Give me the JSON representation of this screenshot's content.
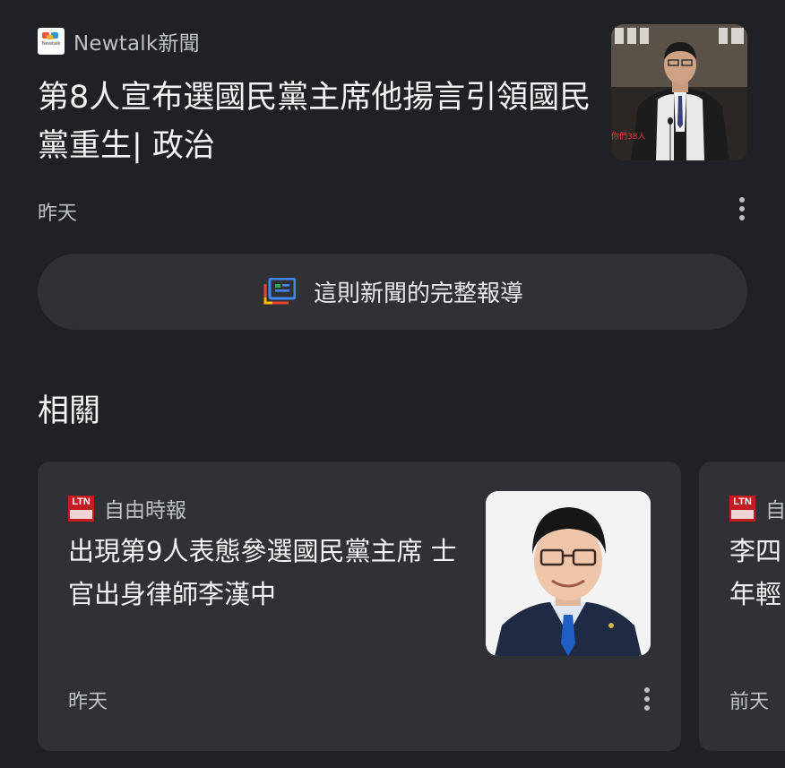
{
  "top_article": {
    "source": "Newtalk新聞",
    "logo_text": "Newtalk",
    "headline": "第8人宣布選國民黨主席他揚言引領國民黨重生| 政治",
    "date": "昨天",
    "thumbnail_caption": "你們38人"
  },
  "full_coverage": {
    "label": "這則新聞的完整報導"
  },
  "related": {
    "title": "相關",
    "cards": [
      {
        "source": "自由時報",
        "logo_text": "LTN",
        "title": "出現第9人表態參選國民黨主席 士官出身律師李漢中",
        "date": "昨天"
      },
      {
        "source": "自",
        "logo_text": "LTN",
        "title_line1": "李四",
        "title_line2": "年輕",
        "date": "前天"
      }
    ]
  },
  "colors": {
    "background": "#202124",
    "surface": "#303134",
    "text_primary": "#f1f3f4",
    "text_secondary": "#bdc1c6",
    "ltn_red": "#c41d20"
  },
  "icons": {
    "more": "more-vert-icon",
    "full_coverage": "full-coverage-icon"
  }
}
